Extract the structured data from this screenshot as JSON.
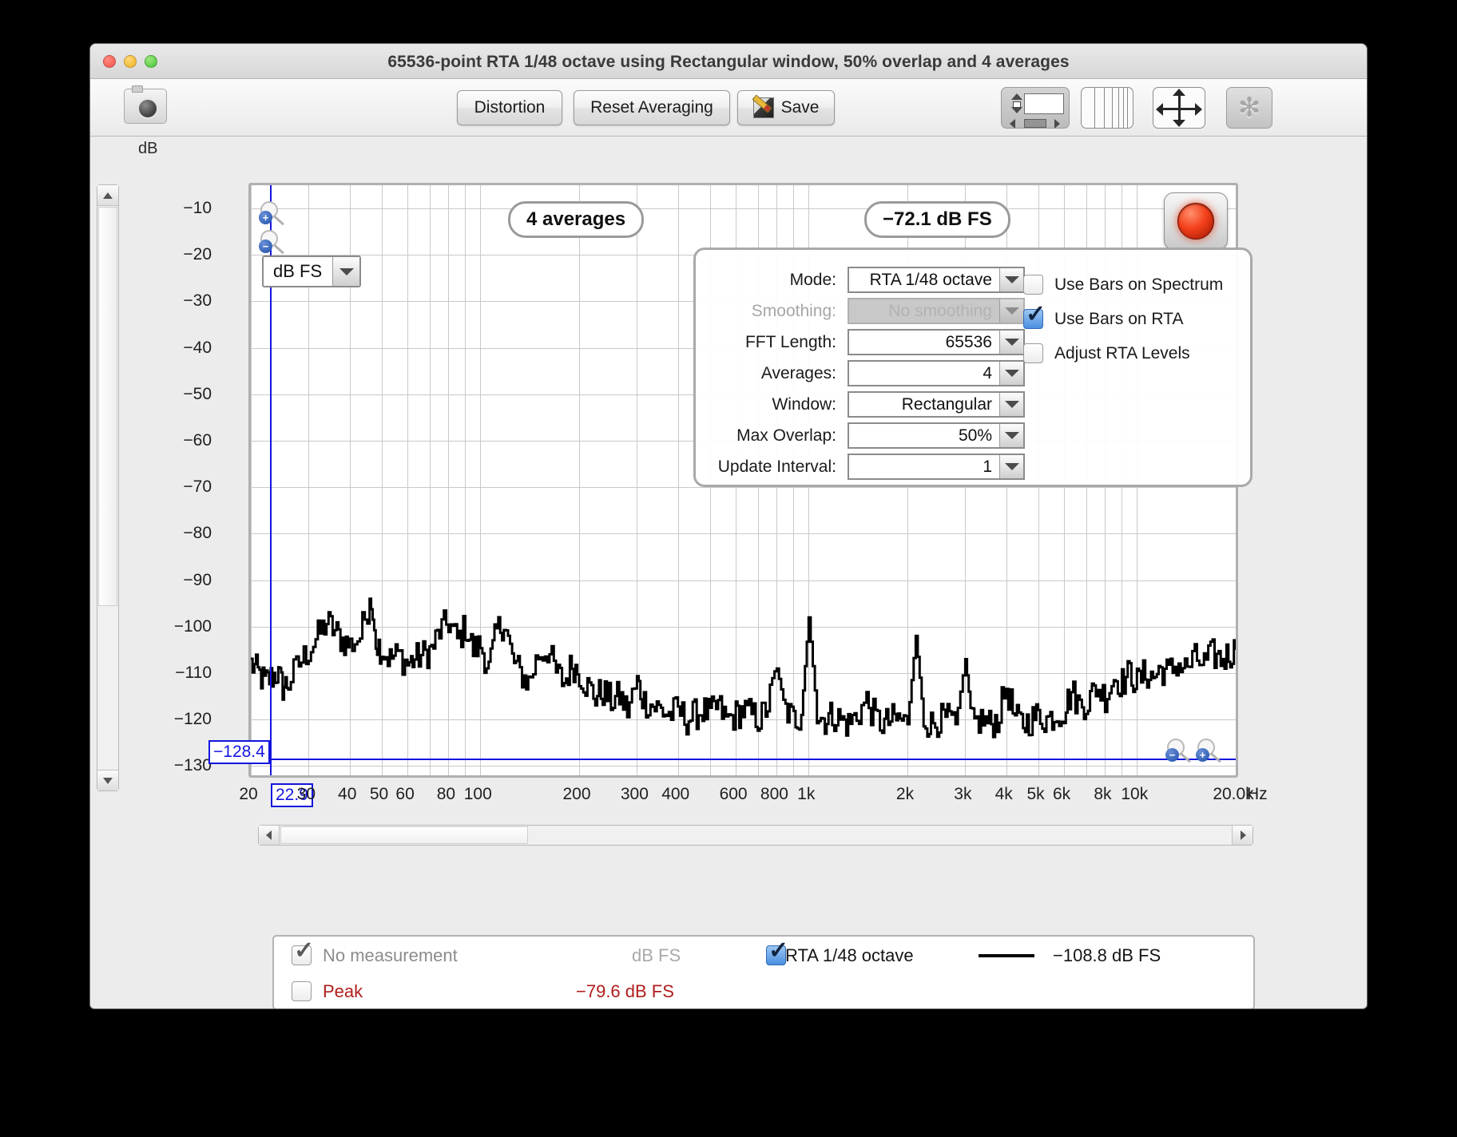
{
  "window": {
    "title": "65536-point RTA 1/48 octave using Rectangular window, 50% overlap and 4 averages"
  },
  "toolbar": {
    "camera_icon": "camera-icon",
    "distortion_label": "Distortion",
    "reset_label": "Reset Averaging",
    "save_label": "Save",
    "save_icon": "save-document-icon",
    "layout_icon": "window-layout-icon",
    "bars_icon": "vertical-bars-icon",
    "pan_icon": "pan-move-icon",
    "gear_icon": "gear-icon",
    "gear_glyph": "✻"
  },
  "plot": {
    "y_axis_title": "dB",
    "y_labels": [
      "-10",
      "-20",
      "-30",
      "-40",
      "-50",
      "-60",
      "-70",
      "-80",
      "-90",
      "-100",
      "-110",
      "-120",
      "-130"
    ],
    "x_labels": [
      "20",
      "30",
      "40",
      "50",
      "60",
      "80",
      "100",
      "200",
      "300",
      "400",
      "600",
      "800",
      "1k",
      "2k",
      "3k",
      "4k",
      "5k",
      "6k",
      "8k",
      "10k",
      "20.0k"
    ],
    "x_unit": "Hz",
    "unit_selector_value": "dB FS",
    "badge_averages": "4 averages",
    "badge_level": "-72.1 dB FS",
    "cursor_y_readout": "-128.4",
    "cursor_x_readout": "22.9",
    "record_button": "record-button",
    "zoom_y_in": "zoom-in-icon",
    "zoom_y_out": "zoom-out-icon",
    "zoom_x_out": "zoom-out-icon",
    "zoom_x_in": "zoom-in-icon",
    "zoom_plus_glyph": "+",
    "zoom_minus_glyph": "−"
  },
  "settings": {
    "rows": [
      {
        "label": "Mode:",
        "value": "RTA 1/48 octave",
        "disabled": false
      },
      {
        "label": "Smoothing:",
        "value": "No  smoothing",
        "disabled": true
      },
      {
        "label": "FFT Length:",
        "value": "65536",
        "disabled": false
      },
      {
        "label": "Averages:",
        "value": "4",
        "disabled": false
      },
      {
        "label": "Window:",
        "value": "Rectangular",
        "disabled": false
      },
      {
        "label": "Max Overlap:",
        "value": "50%",
        "disabled": false
      },
      {
        "label": "Update Interval:",
        "value": "1",
        "disabled": false
      }
    ],
    "checks": [
      {
        "label": "Use Bars on Spectrum",
        "checked": false
      },
      {
        "label": "Use Bars on RTA",
        "checked": true
      },
      {
        "label": "Adjust RTA Levels",
        "checked": false
      }
    ]
  },
  "legend": {
    "row1_label": "No measurement",
    "row1_unit": "dB FS",
    "row2_label": "Peak",
    "row2_value": "-79.6 dB FS",
    "row3_label": "RTA 1/48 octave",
    "row3_value": "-108.8 dB FS"
  },
  "colors": {
    "accent_blue": "#1414e0",
    "trace": "#000000",
    "peak_red": "#b01d1d",
    "record_red": "#f3401a"
  },
  "chart_data": {
    "type": "line",
    "title": "65536-point RTA 1/48 octave using Rectangular window, 50% overlap and 4 averages",
    "xlabel": "Hz",
    "ylabel": "dB",
    "xscale": "log",
    "xlim": [
      20,
      20000
    ],
    "ylim": [
      -132,
      -5
    ],
    "grid": true,
    "legend_position": "bottom",
    "series": [
      {
        "name": "RTA 1/48 octave",
        "unit": "dB FS",
        "x": [
          20,
          21,
          22,
          23,
          24,
          25,
          26,
          28,
          30,
          32,
          34,
          36,
          38,
          40,
          43,
          46,
          48,
          50,
          53,
          56,
          60,
          63,
          67,
          71,
          75,
          80,
          85,
          90,
          95,
          100,
          106,
          112,
          118,
          125,
          132,
          140,
          150,
          160,
          170,
          180,
          190,
          200,
          212,
          224,
          236,
          250,
          265,
          280,
          300,
          315,
          335,
          355,
          375,
          400,
          425,
          450,
          475,
          500,
          530,
          560,
          600,
          630,
          670,
          710,
          750,
          800,
          850,
          900,
          950,
          1000,
          1060,
          1120,
          1180,
          1250,
          1320,
          1400,
          1500,
          1600,
          1700,
          1800,
          1900,
          2000,
          2120,
          2240,
          2360,
          2500,
          2650,
          2800,
          3000,
          3150,
          3350,
          3550,
          3750,
          4000,
          4250,
          4500,
          4750,
          5000,
          5300,
          5600,
          6000,
          6300,
          6700,
          7100,
          7500,
          8000,
          8500,
          9000,
          9500,
          10000,
          10600,
          11200,
          11800,
          12500,
          13200,
          14000,
          15000,
          16000,
          17000,
          18000,
          19000,
          20000
        ],
        "y": [
          -108,
          -110,
          -112,
          -111,
          -110,
          -113,
          -112,
          -108,
          -105,
          -102,
          -99,
          -101,
          -103,
          -104,
          -102,
          -94,
          -103,
          -105,
          -107,
          -106,
          -108,
          -107,
          -106,
          -105,
          -101,
          -99,
          -103,
          -100,
          -105,
          -104,
          -109,
          -101,
          -99,
          -107,
          -110,
          -112,
          -106,
          -105,
          -110,
          -112,
          -108,
          -110,
          -113,
          -115,
          -114,
          -116,
          -115,
          -118,
          -112,
          -116,
          -117,
          -118,
          -119,
          -118,
          -120,
          -119,
          -118,
          -119,
          -117,
          -120,
          -119,
          -118,
          -119,
          -120,
          -117,
          -109,
          -118,
          -120,
          -119,
          -98,
          -119,
          -120,
          -119,
          -120,
          -121,
          -119,
          -116,
          -120,
          -121,
          -120,
          -120,
          -121,
          -102,
          -120,
          -121,
          -120,
          -120,
          -121,
          -107,
          -121,
          -120,
          -121,
          -120,
          -113,
          -120,
          -121,
          -120,
          -119,
          -120,
          -119,
          -118,
          -114,
          -117,
          -116,
          -113,
          -115,
          -111,
          -112,
          -110,
          -112,
          -110,
          -111,
          -109,
          -110,
          -108,
          -109,
          -107,
          -108,
          -106,
          -107,
          -106,
          -105,
          -104
        ],
        "cursor_value": "-108.8 dB FS"
      }
    ],
    "annotations": [
      {
        "text": "4 averages",
        "type": "badge"
      },
      {
        "text": "-72.1 dB FS",
        "type": "badge"
      },
      {
        "text": "-128.4",
        "type": "cursor-y"
      },
      {
        "text": "22.9",
        "type": "cursor-x"
      }
    ]
  }
}
